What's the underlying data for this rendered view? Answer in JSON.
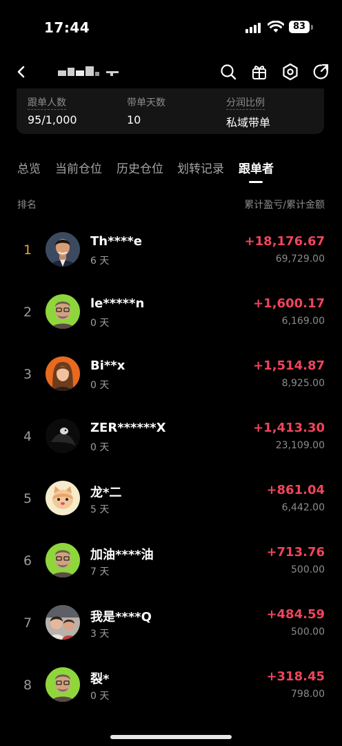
{
  "status": {
    "time": "17:44",
    "battery": "83"
  },
  "info": {
    "followers_label": "跟单人数",
    "followers_value": "95/1,000",
    "days_label": "带单天数",
    "days_value": "10",
    "share_label": "分润比例",
    "share_value": "私域带单"
  },
  "tabs": [
    "总览",
    "当前仓位",
    "历史仓位",
    "划转记录",
    "跟单者"
  ],
  "list": {
    "rank_header": "排名",
    "value_header": "累计盈亏/累计金额"
  },
  "followers": [
    {
      "rank": "1",
      "name": "Th****e",
      "days": "6 天",
      "pnl": "+18,176.67",
      "amount": "69,729.00",
      "avatar": "man-suit-avatar"
    },
    {
      "rank": "2",
      "name": "le*****n",
      "days": "0 天",
      "pnl": "+1,600.17",
      "amount": "6,169.00",
      "avatar": "default-man-green-avatar"
    },
    {
      "rank": "3",
      "name": "Bi**x",
      "days": "0 天",
      "pnl": "+1,514.87",
      "amount": "8,925.00",
      "avatar": "woman-orange-avatar"
    },
    {
      "rank": "4",
      "name": "ZER******X",
      "days": "0 天",
      "pnl": "+1,413.30",
      "amount": "23,109.00",
      "avatar": "dark-bird-avatar"
    },
    {
      "rank": "5",
      "name": "龙*二",
      "days": "5 天",
      "pnl": "+861.04",
      "amount": "6,442.00",
      "avatar": "cartoon-cat-avatar"
    },
    {
      "rank": "6",
      "name": "加油****油",
      "days": "7 天",
      "pnl": "+713.76",
      "amount": "500.00",
      "avatar": "default-man-green-avatar"
    },
    {
      "rank": "7",
      "name": "我是****Q",
      "days": "3 天",
      "pnl": "+484.59",
      "amount": "500.00",
      "avatar": "photo-group-avatar"
    },
    {
      "rank": "8",
      "name": "裂*",
      "days": "0 天",
      "pnl": "+318.45",
      "amount": "798.00",
      "avatar": "default-man-green-avatar"
    }
  ],
  "colors": {
    "positive": "#f0455c",
    "rank_gold": "#e8a33d",
    "background": "#000000",
    "card": "#151515"
  }
}
